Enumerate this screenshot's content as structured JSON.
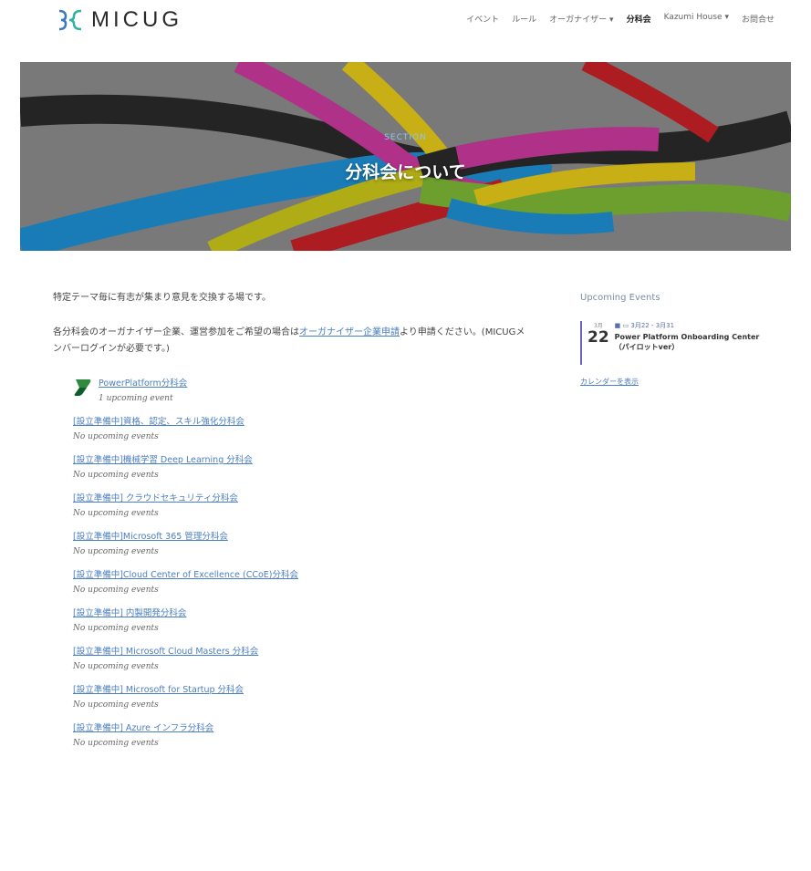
{
  "brand": {
    "name": "MICUG"
  },
  "nav": {
    "items": [
      {
        "label": "イベント",
        "active": false
      },
      {
        "label": "ルール",
        "active": false
      },
      {
        "label": "オーガナイザー ▾",
        "active": false
      },
      {
        "label": "分科会",
        "active": true
      },
      {
        "label": "Kazumi House ▾",
        "active": false
      },
      {
        "label": "お問合せ",
        "active": false
      }
    ]
  },
  "hero": {
    "section_label": "SECTION",
    "title": "分科会について"
  },
  "main": {
    "intro1": "特定テーマ毎に有志が集まり意見を交換する場です。",
    "intro2_before": "各分科会のオーガナイザー企業、運営参加をご希望の場合は",
    "intro2_link": "オーガナイザー企業申請",
    "intro2_after": "より申請ください。(MICUGメンバーログインが必要です。)",
    "groups": [
      {
        "name": "PowerPlatform分科会",
        "status": "1 upcoming event"
      },
      {
        "name": "[設立準備中]資格、認定、スキル強化分科会",
        "status": "No upcoming events"
      },
      {
        "name": "[設立準備中]機械学習 Deep Learning 分科会",
        "status": "No upcoming events"
      },
      {
        "name": "[設立準備中] クラウドセキュリティ分科会",
        "status": "No upcoming events"
      },
      {
        "name": "[設立準備中]Microsoft 365 管理分科会",
        "status": "No upcoming events"
      },
      {
        "name": "[設立準備中]Cloud Center of Excellence (CCoE)分科会",
        "status": "No upcoming events"
      },
      {
        "name": "[設立準備中] 内製開発分科会",
        "status": "No upcoming events"
      },
      {
        "name": "[設立準備中] Microsoft Cloud Masters 分科会",
        "status": "No upcoming events"
      },
      {
        "name": "[設立準備中] Microsoft for Startup 分科会",
        "status": "No upcoming events"
      },
      {
        "name": "[設立準備中] Azure インフラ分科会",
        "status": "No upcoming events"
      }
    ]
  },
  "sidebar": {
    "title": "Upcoming Events",
    "event": {
      "month": "3月",
      "day": "22",
      "meta": "3月22 - 3月31",
      "title": "Power Platform Onboarding Center （パイロットver）"
    },
    "calendar_link": "カレンダーを表示"
  }
}
